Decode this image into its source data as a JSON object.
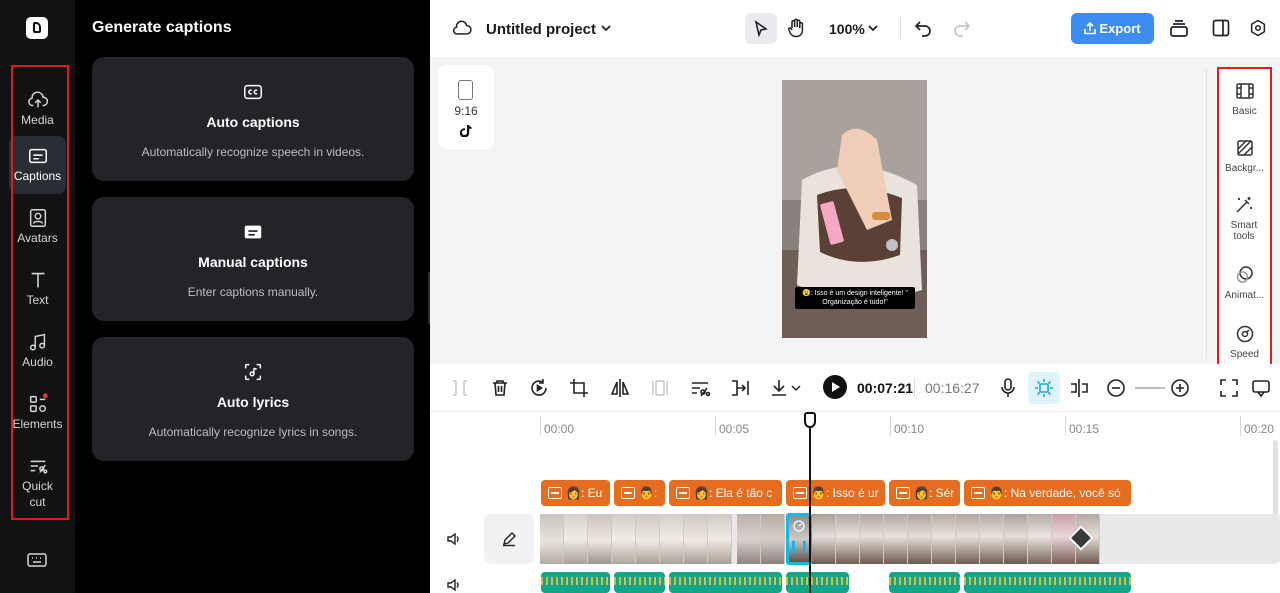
{
  "sidebar": {
    "items": [
      {
        "label": "Media",
        "icon": "cloud-upload-icon"
      },
      {
        "label": "Captions",
        "icon": "captions-icon",
        "active": true
      },
      {
        "label": "Avatars",
        "icon": "avatar-icon"
      },
      {
        "label": "Text",
        "icon": "text-icon"
      },
      {
        "label": "Audio",
        "icon": "music-note-icon"
      },
      {
        "label": "Elements",
        "icon": "elements-icon",
        "badge": true
      },
      {
        "label": "Quick cut",
        "icon": "quick-cut-icon"
      }
    ],
    "keyboard_icon": "keyboard-icon"
  },
  "panel": {
    "title": "Generate captions",
    "cards": [
      {
        "title": "Auto captions",
        "desc": "Automatically recognize speech in videos.",
        "icon": "cc-icon"
      },
      {
        "title": "Manual captions",
        "desc": "Enter captions manually.",
        "icon": "subtitle-icon"
      },
      {
        "title": "Auto lyrics",
        "desc": "Automatically recognize lyrics in songs.",
        "icon": "lyrics-scan-icon"
      }
    ]
  },
  "topbar": {
    "project_title": "Untitled project",
    "zoom": "100%",
    "export_label": "Export"
  },
  "canvas": {
    "ratio": "9:16",
    "subtitle_text": "😮: Isso é um design inteligente! \" Organização é tudo!\""
  },
  "properties": [
    {
      "label": "Basic",
      "icon": "film-icon"
    },
    {
      "label": "Backgr...",
      "icon": "background-icon"
    },
    {
      "label": "Smart tools",
      "icon": "magic-wand-icon"
    },
    {
      "label": "Animat...",
      "icon": "animation-icon"
    },
    {
      "label": "Speed",
      "icon": "speed-icon"
    }
  ],
  "playback": {
    "current": "00:07:21",
    "total": "00:16:27"
  },
  "timeline": {
    "ruler": [
      "00:00",
      "00:05",
      "00:10",
      "00:15",
      "00:20"
    ],
    "caption_clips": [
      {
        "text": "👩: Eu"
      },
      {
        "text": "👨: "
      },
      {
        "text": "👩: Ela é tão c"
      },
      {
        "text": "👨: Isso é ur"
      },
      {
        "text": "👩: Sér"
      },
      {
        "text": "👨: Na verdade, você só"
      }
    ]
  },
  "colors": {
    "accent": "#3b8df2",
    "caption_clip": "#e66d1f",
    "audio_clip": "#13a58a",
    "highlight": "#e01b1b",
    "selection": "#19b7e8"
  }
}
